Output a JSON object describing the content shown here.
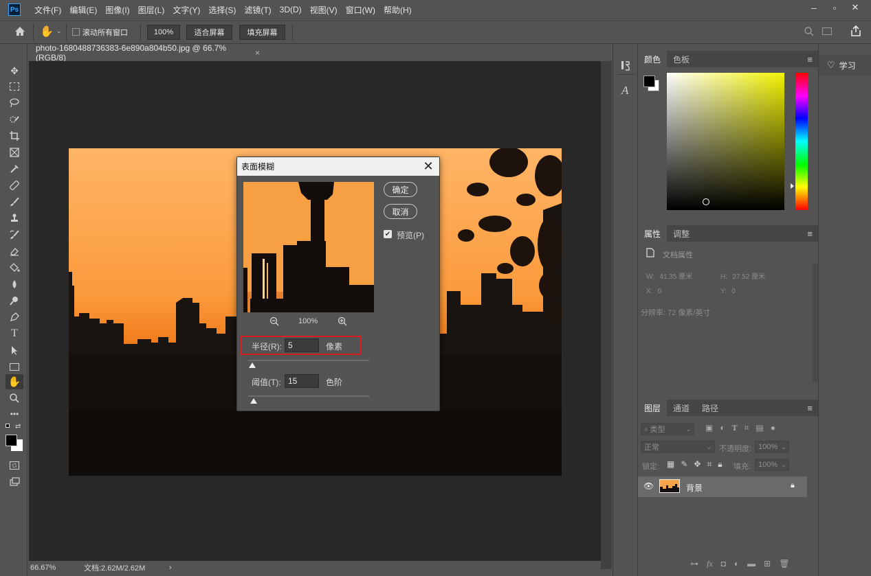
{
  "app": {
    "logo": "Ps",
    "menu": [
      "文件(F)",
      "编辑(E)",
      "图像(I)",
      "图层(L)",
      "文字(Y)",
      "选择(S)",
      "滤镜(T)",
      "3D(D)",
      "视图(V)",
      "窗口(W)",
      "帮助(H)"
    ],
    "window_controls": [
      "–",
      "▫",
      "✕"
    ]
  },
  "options_bar": {
    "scroll_all_label": "滚动所有窗口",
    "zoom_100": "100%",
    "fit_screen": "适合屏幕",
    "fill_screen": "填充屏幕"
  },
  "document": {
    "tab_title": "photo-1680488736383-6e890a804b50.jpg @ 66.7%(RGB/8)",
    "tab_close": "×",
    "status_zoom": "66.67%",
    "status_doc": "文档:2.62M/2.62M",
    "status_arrow": "›"
  },
  "dialog": {
    "title": "表面模糊",
    "close": "✕",
    "ok": "确定",
    "cancel": "取消",
    "preview_label": "预览(P)",
    "preview_checked": true,
    "zoom_level": "100%",
    "radius_label": "半径(R):",
    "radius_value": "5",
    "radius_unit": "像素",
    "threshold_label": "阈值(T):",
    "threshold_value": "15",
    "threshold_unit": "色阶",
    "highlight_color": "#d81e1e"
  },
  "color_panel": {
    "tabs": [
      "颜色",
      "色板"
    ],
    "foreground": "#000000",
    "background": "#ffffff",
    "hue_color": "#f2f200"
  },
  "properties_panel": {
    "tabs": [
      "属性",
      "调整"
    ],
    "section": "文档属性",
    "w_label": "W:",
    "w_value": "41.35 厘米",
    "h_label": "H:",
    "h_value": "27.52 厘米",
    "x_label": "X:",
    "x_value": "0",
    "y_label": "Y:",
    "y_value": "0",
    "resolution": "分辨率: 72 像素/英寸"
  },
  "layers_panel": {
    "tabs": [
      "图层",
      "通道",
      "路径"
    ],
    "filter_kind": "类型",
    "blend_mode": "正常",
    "opacity_label": "不透明度:",
    "opacity_value": "100%",
    "lock_label": "锁定:",
    "fill_label": "填充:",
    "fill_value": "100%",
    "layers": [
      {
        "name": "背景",
        "visible": true,
        "locked": true
      }
    ],
    "footer_icons": [
      "link-icon",
      "fx-icon",
      "mask-icon",
      "adjustment-icon",
      "folder-icon",
      "new-layer-icon",
      "trash-icon"
    ]
  },
  "learn_panel": {
    "label": "学习"
  }
}
